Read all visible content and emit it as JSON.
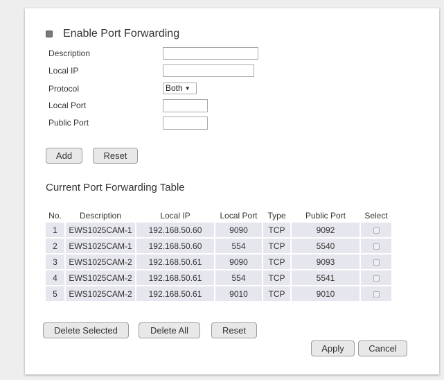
{
  "form": {
    "enable_label": "Enable Port Forwarding",
    "enable_checked": true,
    "fields": {
      "description_label": "Description",
      "local_ip_label": "Local IP",
      "protocol_label": "Protocol",
      "protocol_value": "Both",
      "local_port_label": "Local Port",
      "public_port_label": "Public Port"
    },
    "add_label": "Add",
    "reset_label": "Reset"
  },
  "table": {
    "title": "Current Port Forwarding Table",
    "headers": [
      "No.",
      "Description",
      "Local IP",
      "Local Port",
      "Type",
      "Public Port",
      "Select"
    ],
    "rows": [
      [
        "1",
        "EWS1025CAM-1",
        "192.168.50.60",
        "9090",
        "TCP",
        "9092"
      ],
      [
        "2",
        "EWS1025CAM-1",
        "192.168.50.60",
        "554",
        "TCP",
        "5540"
      ],
      [
        "3",
        "EWS1025CAM-2",
        "192.168.50.61",
        "9090",
        "TCP",
        "9093"
      ],
      [
        "4",
        "EWS1025CAM-2",
        "192.168.50.61",
        "554",
        "TCP",
        "5541"
      ],
      [
        "5",
        "EWS1025CAM-2",
        "192.168.50.61",
        "9010",
        "TCP",
        "9010"
      ]
    ]
  },
  "actions": {
    "delete_selected_label": "Delete Selected",
    "delete_all_label": "Delete All",
    "reset_label": "Reset",
    "apply_label": "Apply",
    "cancel_label": "Cancel"
  }
}
